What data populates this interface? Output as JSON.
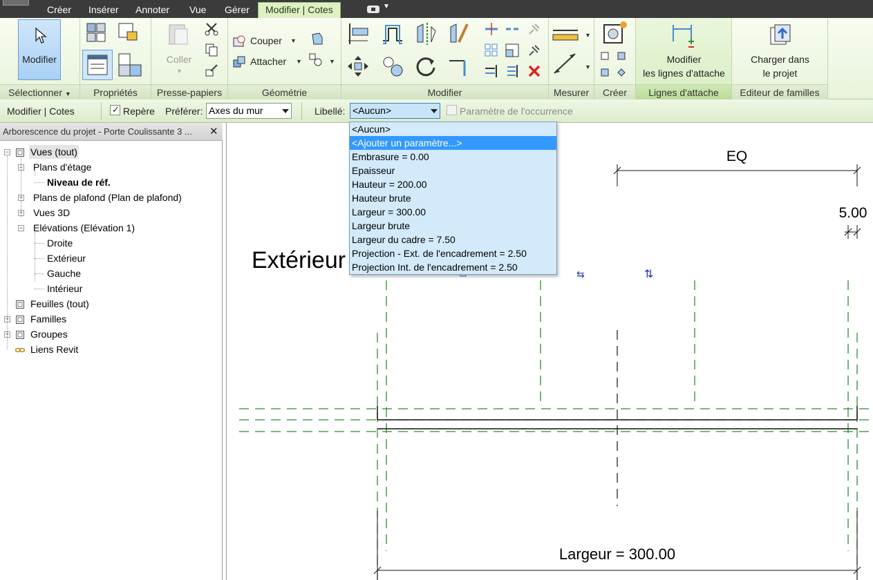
{
  "menu": {
    "tabs": [
      "Créer",
      "Insérer",
      "Annoter",
      "Vue",
      "Gérer",
      "Modifier | Cotes"
    ],
    "active_tab": "Modifier | Cotes"
  },
  "ribbon": {
    "modify_button": "Modifier",
    "paste_button": "Coller",
    "cut_label": "Couper",
    "attach_label": "Attacher",
    "modify_attach_lines": [
      "Modifier",
      "les lignes d'attache"
    ],
    "load_into_project": [
      "Charger dans",
      "le projet"
    ],
    "panels": {
      "select": "Sélectionner",
      "properties": "Propriétés",
      "clipboard": "Presse-papiers",
      "geometry": "Géométrie",
      "modify": "Modifier",
      "measure": "Mesurer",
      "create": "Créer",
      "attach_lines": "Lignes d'attache",
      "family_editor": "Editeur de familles"
    }
  },
  "options_bar": {
    "context_label": "Modifier | Cotes",
    "repere_label": "Repère",
    "repere_checked": true,
    "prefer_label": "Préférer:",
    "prefer_value": "Axes du mur",
    "libelle_label": "Libellé:",
    "libelle_value": "<Aucun>",
    "occurrence_label": "Paramètre de l'occurrence",
    "occurrence_checked": false
  },
  "dropdown": {
    "items": [
      "<Aucun>",
      "<Ajouter un paramètre...>",
      "Embrasure = 0.00",
      "Epaisseur",
      "Hauteur = 200.00",
      "Hauteur brute",
      "Largeur = 300.00",
      "Largeur brute",
      "Largeur du cadre = 7.50",
      "Projection - Ext. de l'encadrement = 2.50",
      "Projection Int. de l'encadrement = 2.50"
    ],
    "highlighted_index": 1
  },
  "browser": {
    "title": "Arborescence du projet - Porte Coulissante 3 ...",
    "tree": [
      {
        "label": "Vues (tout)",
        "level": 0,
        "expander": "-",
        "icon": "views-icon",
        "bold": false,
        "highlight": true
      },
      {
        "label": "Plans d'étage",
        "level": 1,
        "expander": "-",
        "bold": false
      },
      {
        "label": "Niveau de réf.",
        "level": 2,
        "expander": "",
        "bold": true
      },
      {
        "label": "Plans de plafond (Plan de plafond)",
        "level": 1,
        "expander": "+",
        "bold": false
      },
      {
        "label": "Vues 3D",
        "level": 1,
        "expander": "+",
        "bold": false
      },
      {
        "label": "Elévations (Elévation 1)",
        "level": 1,
        "expander": "-",
        "bold": false
      },
      {
        "label": "Droite",
        "level": 2,
        "expander": "",
        "bold": false
      },
      {
        "label": "Extérieur",
        "level": 2,
        "expander": "",
        "bold": false
      },
      {
        "label": "Gauche",
        "level": 2,
        "expander": "",
        "bold": false
      },
      {
        "label": "Intérieur",
        "level": 2,
        "expander": "",
        "bold": false
      },
      {
        "label": "Feuilles (tout)",
        "level": 0,
        "expander": "",
        "icon": "sheets-icon",
        "bold": false
      },
      {
        "label": "Familles",
        "level": 0,
        "expander": "+",
        "icon": "families-icon",
        "bold": false
      },
      {
        "label": "Groupes",
        "level": 0,
        "expander": "+",
        "icon": "groups-icon",
        "bold": false
      },
      {
        "label": "Liens Revit",
        "level": 0,
        "expander": "",
        "icon": "links-icon",
        "bold": false
      }
    ]
  },
  "canvas": {
    "view_label": "Extérieur",
    "dim_eq": "EQ",
    "dim_small": "5.00",
    "dim_width": "Largeur = 300.00"
  },
  "colors": {
    "accent_green": "#dff0c4",
    "ref_plane_green": "#2e8b2e",
    "selection_blue": "#3399ff"
  }
}
